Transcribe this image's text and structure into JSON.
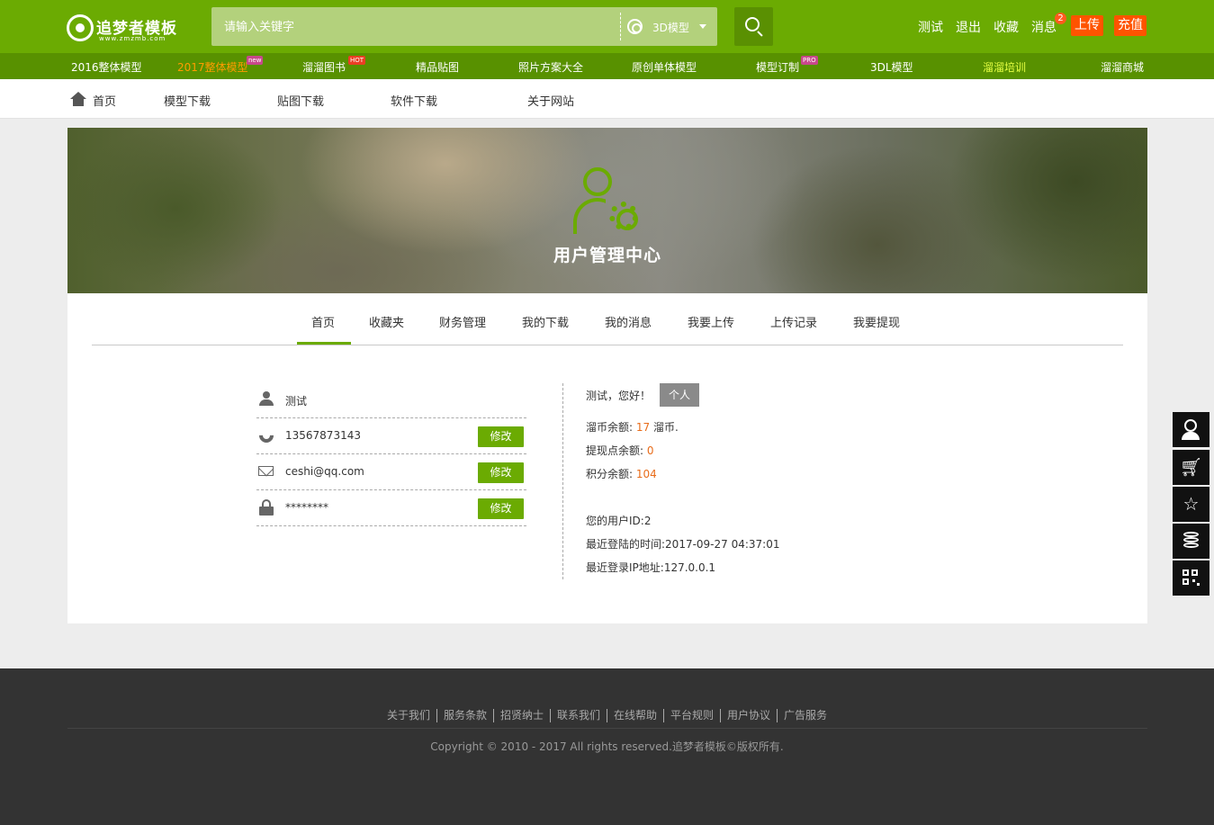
{
  "header": {
    "logo_title": "追梦者模板",
    "logo_url": "www.zmzmb.com",
    "search_placeholder": "请输入关键字",
    "search_type": "3D模型",
    "links": [
      "测试",
      "退出",
      "收藏",
      "消息"
    ],
    "message_count": "2",
    "upload_label": "上传",
    "recharge_label": "充值",
    "colors": {
      "primary": "#6bab02",
      "accent": "#ff5400"
    }
  },
  "categories": [
    {
      "label": "2016整体模型",
      "tag": ""
    },
    {
      "label": "2017整体模型",
      "tag": "new"
    },
    {
      "label": "溜溜图书",
      "tag": "HOT"
    },
    {
      "label": "精品贴图",
      "tag": ""
    },
    {
      "label": "照片方案大全",
      "tag": ""
    },
    {
      "label": "原创单体模型",
      "tag": ""
    },
    {
      "label": "模型订制",
      "tag": "PRO"
    },
    {
      "label": "3DL模型",
      "tag": ""
    },
    {
      "label": "溜溜培训",
      "tag": ""
    },
    {
      "label": "溜溜商城",
      "tag": ""
    }
  ],
  "subnav": [
    "首页",
    "模型下载",
    "贴图下载",
    "软件下载",
    "关于网站"
  ],
  "banner": {
    "title": "用户管理中心"
  },
  "tabs": [
    "首页",
    "收藏夹",
    "财务管理",
    "我的下载",
    "我的消息",
    "我要上传",
    "上传记录",
    "我要提现"
  ],
  "active_tab": "首页",
  "profile": {
    "username": "测试",
    "phone": "13567873143",
    "email": "ceshi@qq.com",
    "password_mask": "********",
    "edit_label": "修改"
  },
  "account": {
    "greeting": "测试，您好！",
    "role": "个人",
    "coins_label": "溜币余额:",
    "coins_value": "17",
    "coins_unit": "溜币.",
    "withdraw_label": "提现点余额:",
    "withdraw_value": "0",
    "points_label": "积分余额:",
    "points_value": "104",
    "user_id": "您的用户ID:2",
    "last_login": "最近登陆的时间:2017-09-27 04:37:01",
    "last_ip": "最近登录IP地址:127.0.0.1"
  },
  "side_tools": [
    "customer-service-icon",
    "cart-icon",
    "star-icon",
    "coins-icon",
    "qrcode-icon"
  ],
  "footer": {
    "links": [
      "关于我们",
      "服务条款",
      "招贤纳士",
      "联系我们",
      "在线帮助",
      "平台规则",
      "用户协议",
      "广告服务"
    ],
    "copyright": "Copyright © 2010 - 2017 All rights reserved.追梦者模板©版权所有."
  }
}
